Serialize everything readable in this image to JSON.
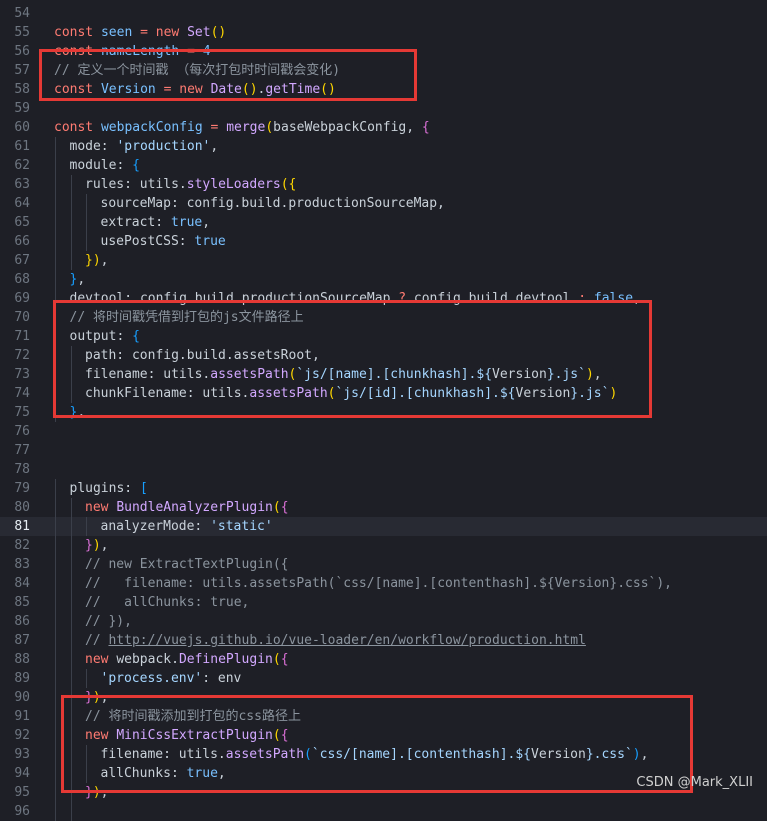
{
  "editor": {
    "current_line": 81,
    "lines": [
      {
        "n": 54,
        "indent": 0,
        "tokens": []
      },
      {
        "n": 55,
        "indent": 0,
        "tokens": [
          [
            "kw",
            "const "
          ],
          [
            "var",
            "seen"
          ],
          [
            "op",
            " = "
          ],
          [
            "kw",
            "new "
          ],
          [
            "fn",
            "Set"
          ],
          [
            "br1",
            "()"
          ]
        ]
      },
      {
        "n": 56,
        "indent": 0,
        "tokens": [
          [
            "kw",
            "const "
          ],
          [
            "var",
            "nameLength"
          ],
          [
            "op",
            " = "
          ],
          [
            "num",
            "4"
          ]
        ]
      },
      {
        "n": 57,
        "indent": 0,
        "tokens": [
          [
            "cm",
            "// 定义一个时间戳 （每次打包时时间戳会变化)"
          ]
        ]
      },
      {
        "n": 58,
        "indent": 0,
        "tokens": [
          [
            "kw",
            "const "
          ],
          [
            "var",
            "Version"
          ],
          [
            "op",
            " = "
          ],
          [
            "kw",
            "new "
          ],
          [
            "fn",
            "Date"
          ],
          [
            "br1",
            "()"
          ],
          [
            "punc",
            "."
          ],
          [
            "fn",
            "getTime"
          ],
          [
            "br1",
            "()"
          ]
        ]
      },
      {
        "n": 59,
        "indent": 0,
        "tokens": []
      },
      {
        "n": 60,
        "indent": 0,
        "tokens": [
          [
            "kw",
            "const "
          ],
          [
            "var",
            "webpackConfig"
          ],
          [
            "op",
            " = "
          ],
          [
            "fn",
            "merge"
          ],
          [
            "br1",
            "("
          ],
          [
            "punc",
            "baseWebpackConfig, "
          ],
          [
            "br2",
            "{"
          ]
        ]
      },
      {
        "n": 61,
        "indent": 1,
        "tokens": [
          [
            "prop",
            "mode: "
          ],
          [
            "str",
            "'production'"
          ],
          [
            "punc",
            ","
          ]
        ]
      },
      {
        "n": 62,
        "indent": 1,
        "tokens": [
          [
            "prop",
            "module: "
          ],
          [
            "br3",
            "{"
          ]
        ]
      },
      {
        "n": 63,
        "indent": 2,
        "tokens": [
          [
            "prop",
            "rules: "
          ],
          [
            "punc",
            "utils."
          ],
          [
            "fn",
            "styleLoaders"
          ],
          [
            "br1",
            "({"
          ]
        ]
      },
      {
        "n": 64,
        "indent": 3,
        "tokens": [
          [
            "prop",
            "sourceMap: "
          ],
          [
            "punc",
            "config.build.productionSourceMap,"
          ]
        ]
      },
      {
        "n": 65,
        "indent": 3,
        "tokens": [
          [
            "prop",
            "extract: "
          ],
          [
            "bool",
            "true"
          ],
          [
            "punc",
            ","
          ]
        ]
      },
      {
        "n": 66,
        "indent": 3,
        "tokens": [
          [
            "prop",
            "usePostCSS: "
          ],
          [
            "bool",
            "true"
          ]
        ]
      },
      {
        "n": 67,
        "indent": 2,
        "tokens": [
          [
            "br1",
            "})"
          ],
          [
            "punc",
            ","
          ]
        ]
      },
      {
        "n": 68,
        "indent": 1,
        "tokens": [
          [
            "br3",
            "}"
          ],
          [
            "punc",
            ","
          ]
        ]
      },
      {
        "n": 69,
        "indent": 1,
        "tokens": [
          [
            "prop",
            "devtool: "
          ],
          [
            "punc",
            "config.build.productionSourceMap "
          ],
          [
            "op",
            "?"
          ],
          [
            "punc",
            " config.build.devtool "
          ],
          [
            "op",
            ":"
          ],
          [
            "bool",
            " false"
          ],
          [
            "punc",
            ","
          ]
        ]
      },
      {
        "n": 70,
        "indent": 1,
        "tokens": [
          [
            "cm",
            "// 将时间戳凭借到打包的js文件路径上"
          ]
        ]
      },
      {
        "n": 71,
        "indent": 1,
        "tokens": [
          [
            "prop",
            "output: "
          ],
          [
            "br3",
            "{"
          ]
        ]
      },
      {
        "n": 72,
        "indent": 2,
        "tokens": [
          [
            "prop",
            "path: "
          ],
          [
            "punc",
            "config.build.assetsRoot,"
          ]
        ]
      },
      {
        "n": 73,
        "indent": 2,
        "tokens": [
          [
            "prop",
            "filename: "
          ],
          [
            "punc",
            "utils."
          ],
          [
            "fn",
            "assetsPath"
          ],
          [
            "br1",
            "("
          ],
          [
            "str",
            "`js/[name].[chunkhash].${"
          ],
          [
            "punc",
            "Version"
          ],
          [
            "str",
            "}.js`"
          ],
          [
            "br1",
            ")"
          ],
          [
            "punc",
            ","
          ]
        ]
      },
      {
        "n": 74,
        "indent": 2,
        "tokens": [
          [
            "prop",
            "chunkFilename: "
          ],
          [
            "punc",
            "utils."
          ],
          [
            "fn",
            "assetsPath"
          ],
          [
            "br1",
            "("
          ],
          [
            "str",
            "`js/[id].[chunkhash].${"
          ],
          [
            "punc",
            "Version"
          ],
          [
            "str",
            "}.js`"
          ],
          [
            "br1",
            ")"
          ]
        ]
      },
      {
        "n": 75,
        "indent": 1,
        "tokens": [
          [
            "br3",
            "}"
          ],
          [
            "punc",
            ","
          ]
        ]
      },
      {
        "n": 76,
        "indent": 0,
        "tokens": []
      },
      {
        "n": 77,
        "indent": 0,
        "tokens": []
      },
      {
        "n": 78,
        "indent": 0,
        "tokens": []
      },
      {
        "n": 79,
        "indent": 1,
        "tokens": [
          [
            "prop",
            "plugins: "
          ],
          [
            "br3",
            "["
          ]
        ]
      },
      {
        "n": 80,
        "indent": 2,
        "tokens": [
          [
            "kw",
            "new "
          ],
          [
            "fn",
            "BundleAnalyzerPlugin"
          ],
          [
            "br1",
            "("
          ],
          [
            "br2",
            "{"
          ]
        ]
      },
      {
        "n": 81,
        "indent": 3,
        "tokens": [
          [
            "prop",
            "analyzerMode: "
          ],
          [
            "str",
            "'static'"
          ]
        ]
      },
      {
        "n": 82,
        "indent": 2,
        "tokens": [
          [
            "br2",
            "}"
          ],
          [
            "br1",
            ")"
          ],
          [
            "punc",
            ","
          ]
        ]
      },
      {
        "n": 83,
        "indent": 2,
        "tokens": [
          [
            "cm",
            "// new ExtractTextPlugin({"
          ]
        ]
      },
      {
        "n": 84,
        "indent": 2,
        "tokens": [
          [
            "cm",
            "//   filename: utils.assetsPath(`css/[name].[contenthash].${Version}.css`),"
          ]
        ]
      },
      {
        "n": 85,
        "indent": 2,
        "tokens": [
          [
            "cm",
            "//   allChunks: true,"
          ]
        ]
      },
      {
        "n": 86,
        "indent": 2,
        "tokens": [
          [
            "cm",
            "// }),"
          ]
        ]
      },
      {
        "n": 87,
        "indent": 2,
        "tokens": [
          [
            "cm",
            "// "
          ],
          [
            "link",
            "http://vuejs.github.io/vue-loader/en/workflow/production.html"
          ]
        ]
      },
      {
        "n": 88,
        "indent": 2,
        "tokens": [
          [
            "kw",
            "new "
          ],
          [
            "punc",
            "webpack."
          ],
          [
            "fn",
            "DefinePlugin"
          ],
          [
            "br1",
            "("
          ],
          [
            "br2",
            "{"
          ]
        ]
      },
      {
        "n": 89,
        "indent": 3,
        "tokens": [
          [
            "str",
            "'process.env'"
          ],
          [
            "punc",
            ": env"
          ]
        ]
      },
      {
        "n": 90,
        "indent": 2,
        "tokens": [
          [
            "br2",
            "}"
          ],
          [
            "br1",
            ")"
          ],
          [
            "punc",
            ","
          ]
        ]
      },
      {
        "n": 91,
        "indent": 2,
        "tokens": [
          [
            "cm",
            "// 将时间戳添加到打包的css路径上"
          ]
        ]
      },
      {
        "n": 92,
        "indent": 2,
        "tokens": [
          [
            "kw",
            "new "
          ],
          [
            "fn",
            "MiniCssExtractPlugin"
          ],
          [
            "br1",
            "("
          ],
          [
            "br2",
            "{"
          ]
        ]
      },
      {
        "n": 93,
        "indent": 3,
        "tokens": [
          [
            "prop",
            "filename: "
          ],
          [
            "punc",
            "utils."
          ],
          [
            "fn",
            "assetsPath"
          ],
          [
            "br3",
            "("
          ],
          [
            "str",
            "`css/[name].[contenthash].${"
          ],
          [
            "punc",
            "Version"
          ],
          [
            "str",
            "}.css`"
          ],
          [
            "br3",
            ")"
          ],
          [
            "punc",
            ","
          ]
        ]
      },
      {
        "n": 94,
        "indent": 3,
        "tokens": [
          [
            "prop",
            "allChunks: "
          ],
          [
            "bool",
            "true"
          ],
          [
            "punc",
            ","
          ]
        ]
      },
      {
        "n": 95,
        "indent": 2,
        "tokens": [
          [
            "br2",
            "}"
          ],
          [
            "br1",
            ")"
          ],
          [
            "punc",
            ","
          ]
        ]
      },
      {
        "n": 96,
        "indent": 2,
        "tokens": []
      }
    ]
  },
  "watermark": "CSDN @Mark_XLII",
  "highlight_color": "#e53935"
}
